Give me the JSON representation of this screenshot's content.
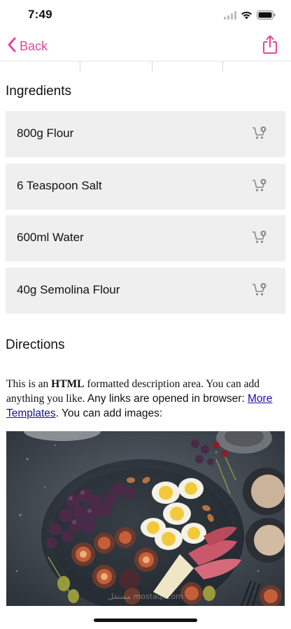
{
  "status_bar": {
    "time": "7:49",
    "icons": [
      "signal-icon",
      "wifi-icon",
      "battery-icon"
    ]
  },
  "nav": {
    "back_label": "Back",
    "accent_color": "#e8459a"
  },
  "ingredients": {
    "title": "Ingredients",
    "items": [
      {
        "label": "800g Flour"
      },
      {
        "label": "6 Teaspoon Salt"
      },
      {
        "label": "600ml Water"
      },
      {
        "label": "40g Semolina Flour"
      }
    ],
    "item_icon": "add-to-cart-icon"
  },
  "directions": {
    "title": "Directions",
    "desc_prefix": "This is an ",
    "desc_bold": "HTML",
    "desc_mid": " formatted description area. You can add anything you like.",
    "desc_line2a": " Any links are opened in browser: ",
    "link_text": "More Templates",
    "desc_end": ". You can add images:"
  },
  "image": {
    "subject": "food-platter-image",
    "watermark": "مستقل mostaql.com"
  }
}
